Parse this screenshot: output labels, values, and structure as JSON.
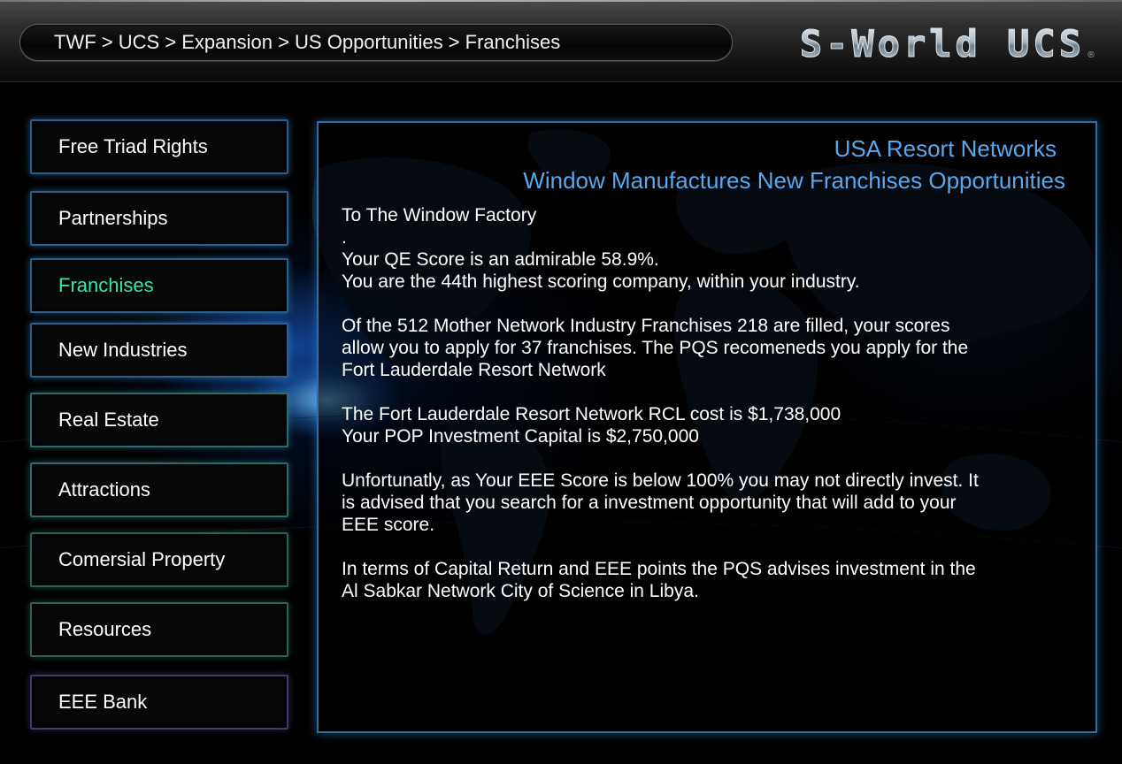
{
  "header": {
    "breadcrumb": "TWF > UCS > Expansion > US Opportunities > Franchises",
    "logo": "S-World UCS",
    "logo_mark": "®"
  },
  "sidebar": {
    "items": [
      {
        "label": "Free Triad Rights",
        "active": false
      },
      {
        "label": "Partnerships",
        "active": false
      },
      {
        "label": "Franchises",
        "active": true
      },
      {
        "label": "New Industries",
        "active": false
      },
      {
        "label": "Real Estate",
        "active": false
      },
      {
        "label": "Attractions",
        "active": false
      },
      {
        "label": "Comersial Property",
        "active": false
      },
      {
        "label": "Resources",
        "active": false
      },
      {
        "label": "EEE Bank",
        "active": false
      }
    ]
  },
  "main": {
    "title_line1": "USA Resort Networks",
    "title_line2": "Window Manufactures New Franchises Opportunities",
    "salutation": "To The Window Factory",
    "dot": ".",
    "qe_score": "Your QE Score is an admirable 58.9%.",
    "ranking": "You are the 44th highest scoring company, within your industry.",
    "franchises_line1": "Of the 512 Mother Network Industry Franchises 218 are filled, your scores",
    "franchises_line2": "allow you to apply for 37 franchises. The PQS recomeneds you apply for the",
    "franchises_line3": "Fort Lauderdale Resort Network",
    "rcl_cost": "The Fort Lauderdale Resort Network RCL cost is $1,738,000",
    "pop_capital": "Your POP Investment Capital is $2,750,000",
    "eee_line1": "Unfortunatly, as Your EEE Score is below 100% you may not directly invest. It",
    "eee_line2": "is advised that you search for a investment opportunity that will add to your",
    "eee_line3": "EEE score.",
    "advice_line1": "In terms of Capital Return and EEE points the PQS advises investment in the",
    "advice_line2": "Al Sabkar Network City of Science in Libya."
  },
  "colors": {
    "active_nav": "#36e8a0",
    "title_blue": "#5aa8ec",
    "panel_border": "#2f6fa0"
  }
}
